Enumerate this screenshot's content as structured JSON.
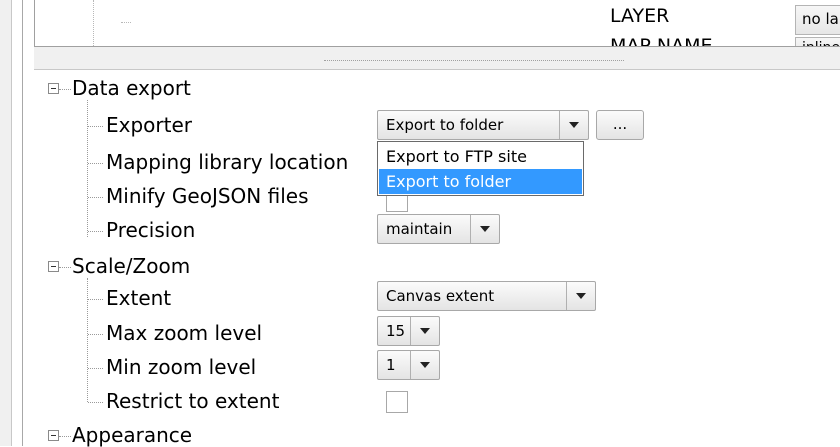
{
  "upper_panel": {
    "layer_label": "LAYER",
    "layer_value": "no label",
    "mapname_label": "MAP NAME",
    "mapname_value": "inline"
  },
  "sections": {
    "data_export": {
      "title": "Data export",
      "exporter": {
        "label": "Exporter",
        "value": "Export to folder",
        "browse_label": "..."
      },
      "mapping_library": {
        "label": "Mapping library location"
      },
      "minify": {
        "label": "Minify GeoJSON files",
        "checked": false
      },
      "precision": {
        "label": "Precision",
        "value": "maintain"
      }
    },
    "scale_zoom": {
      "title": "Scale/Zoom",
      "extent": {
        "label": "Extent",
        "value": "Canvas extent"
      },
      "max_zoom": {
        "label": "Max zoom level",
        "value": "15"
      },
      "min_zoom": {
        "label": "Min zoom level",
        "value": "1"
      },
      "restrict": {
        "label": "Restrict to extent",
        "checked": false
      }
    },
    "appearance": {
      "title": "Appearance"
    }
  },
  "exporter_dropdown": {
    "options": [
      "Export to FTP site",
      "Export to folder"
    ],
    "selected": "Export to folder"
  },
  "colors": {
    "selection": "#3399ff"
  }
}
